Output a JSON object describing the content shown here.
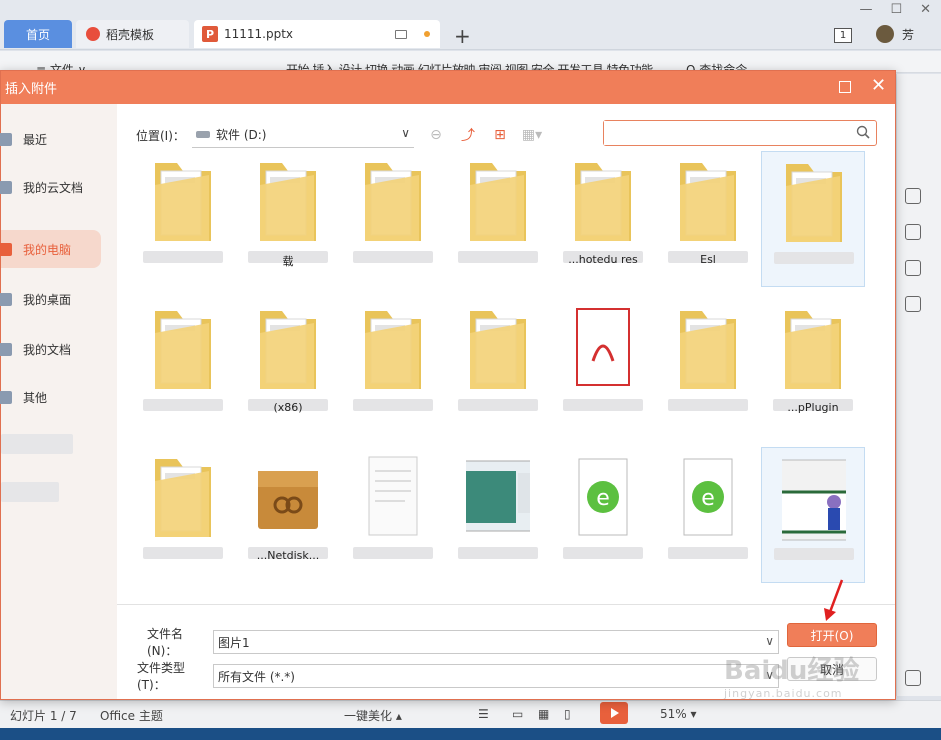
{
  "tabs": [
    {
      "label": "首页"
    },
    {
      "label": "稻壳模板"
    },
    {
      "label": "11111.pptx"
    }
  ],
  "window": {
    "badge": "1",
    "user": "芳"
  },
  "ribbon": {
    "menu": "≡ 文件 ∨",
    "tabs": "开始 插入 设计 切换 动画 幻灯片放映 审阅 视图 安全 开发工具 特色功能",
    "find": "Q 查找命令"
  },
  "dialog": {
    "title": "插入附件",
    "sidebar": [
      "最近",
      "我的云文档",
      "我的电脑",
      "我的桌面",
      "我的文档",
      "其他"
    ],
    "active_sidebar": "我的电脑",
    "location_label": "位置(I)：",
    "location_value": "软件 (D:)",
    "search_placeholder": "",
    "files": [
      {
        "label": "",
        "kind": "folder"
      },
      {
        "label": "载",
        "kind": "folder"
      },
      {
        "label": "",
        "kind": "folder"
      },
      {
        "label": "",
        "kind": "folder"
      },
      {
        "label": "...hotedu res",
        "kind": "folder"
      },
      {
        "label": "Esl",
        "kind": "folder"
      },
      {
        "label": "",
        "kind": "folder"
      },
      {
        "label": "",
        "kind": "folder"
      },
      {
        "label": "(x86)",
        "kind": "folder"
      },
      {
        "label": "",
        "kind": "folder"
      },
      {
        "label": "",
        "kind": "folder"
      },
      {
        "label": "",
        "kind": "pdf"
      },
      {
        "label": "",
        "kind": "folder"
      },
      {
        "label": "...pPlugin",
        "kind": "folder"
      },
      {
        "label": "",
        "kind": "folder"
      },
      {
        "label": "...Netdisk...",
        "kind": "archive"
      },
      {
        "label": "",
        "kind": "document"
      },
      {
        "label": "",
        "kind": "image"
      },
      {
        "label": "",
        "kind": "ie-file"
      },
      {
        "label": "",
        "kind": "ie-file"
      },
      {
        "label": "",
        "kind": "picture"
      }
    ],
    "filename_label": "文件名(N)：",
    "filename_value": "图片1",
    "filetype_label": "文件类型(T)：",
    "filetype_value": "所有文件 (*.*)",
    "open_button": "打开(O)",
    "cancel_button": "取消"
  },
  "statusbar": {
    "slide": "幻灯片 1 / 7",
    "theme": "Office 主题",
    "beautify": "一键美化 ▴",
    "zoom": "51% ▾"
  },
  "watermark": {
    "main": "Baidu经验",
    "sub": "jingyan.baidu.com"
  },
  "colors": {
    "accent": "#f07e59",
    "active_tab": "#5a8fe0",
    "folder": "#f3d27a"
  }
}
